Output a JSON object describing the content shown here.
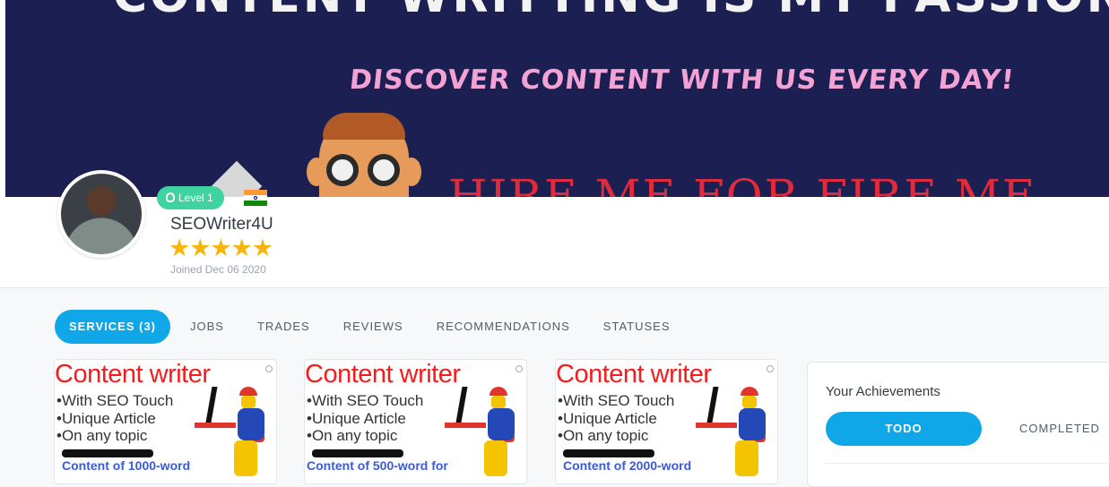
{
  "banner": {
    "title": "CONTENT WRITTING IS MY PASSION",
    "subtitle": "DISCOVER CONTENT WITH US EVERY DAY!",
    "hire_text": "HIRE ME FOR FIRE ME"
  },
  "profile": {
    "level": "Level 1",
    "username": "SEOWriter4U",
    "stars": "★★★★★",
    "rating": 5,
    "joined": "Joined Dec 06 2020",
    "country_flag": "india-flag-icon"
  },
  "tabs": [
    {
      "label": "SERVICES (3)",
      "active": true
    },
    {
      "label": "JOBS",
      "active": false
    },
    {
      "label": "TRADES",
      "active": false
    },
    {
      "label": "REVIEWS",
      "active": false
    },
    {
      "label": "RECOMMENDATIONS",
      "active": false
    },
    {
      "label": "STATUSES",
      "active": false
    }
  ],
  "services": [
    {
      "title": "Content writer",
      "line1": "•With SEO Touch",
      "line2": "•Unique Article",
      "line3": "•On any topic",
      "bottom": "Content of 1000-word"
    },
    {
      "title": "Content writer",
      "line1": "•With SEO Touch",
      "line2": "•Unique Article",
      "line3": "•On any topic",
      "bottom": "Content of 500-word for"
    },
    {
      "title": "Content writer",
      "line1": "•With SEO Touch",
      "line2": "•Unique Article",
      "line3": "•On any topic",
      "bottom": "Content of 2000-word"
    }
  ],
  "achievements": {
    "title": "Your Achievements",
    "todo_label": "TODO",
    "completed_label": "COMPLETED"
  },
  "colors": {
    "accent": "#10a7e8",
    "level_badge": "#3ed3a0",
    "star": "#f5b50a",
    "banner_bg": "#1c1f52"
  }
}
